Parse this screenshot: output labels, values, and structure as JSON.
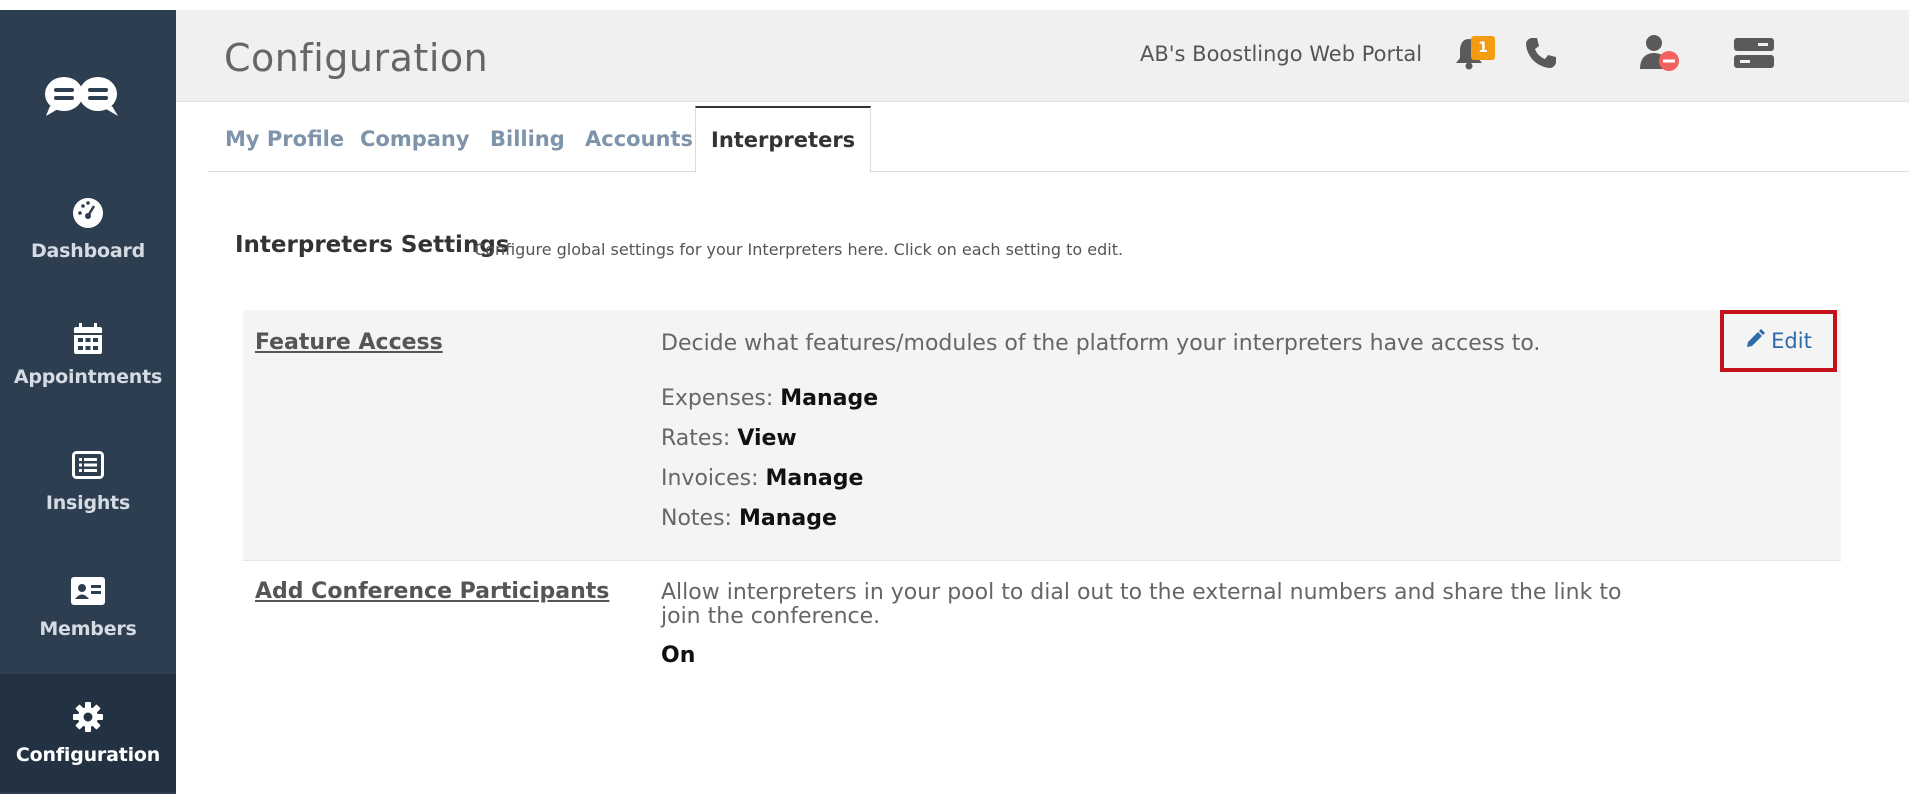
{
  "sidebar": {
    "items": [
      {
        "label": "Dashboard",
        "icon": "dashboard-icon"
      },
      {
        "label": "Appointments",
        "icon": "calendar-icon"
      },
      {
        "label": "Insights",
        "icon": "list-icon"
      },
      {
        "label": "Members",
        "icon": "id-card-icon"
      },
      {
        "label": "Configuration",
        "icon": "gear-icon"
      }
    ]
  },
  "header": {
    "title": "Configuration",
    "portal_name": "AB's Boostlingo Web Portal",
    "notification_count": "1"
  },
  "tabs": [
    {
      "label": "My Profile"
    },
    {
      "label": "Company"
    },
    {
      "label": "Billing"
    },
    {
      "label": "Accounts"
    },
    {
      "label": "Interpreters"
    }
  ],
  "section": {
    "title": "Interpreters Settings",
    "subtitle": "Configure global settings for your Interpreters here. Click on each setting to edit."
  },
  "settings": [
    {
      "name": "Feature Access",
      "description": "Decide what features/modules of the platform your interpreters have access to.",
      "edit_label": "Edit",
      "values": [
        {
          "key": "Expenses:",
          "value": "Manage"
        },
        {
          "key": "Rates:",
          "value": "View"
        },
        {
          "key": "Invoices:",
          "value": "Manage"
        },
        {
          "key": "Notes:",
          "value": "Manage"
        }
      ]
    },
    {
      "name": "Add Conference Participants",
      "description": "Allow interpreters in your pool to dial out to the external numbers and share the link to join the conference.",
      "value": "On"
    }
  ],
  "colors": {
    "sidebar_bg": "#2d3e50",
    "tab_inactive": "#7e94ab",
    "badge": "#f39c12",
    "highlight_border": "#c4121d",
    "link": "#2d6ca8"
  }
}
